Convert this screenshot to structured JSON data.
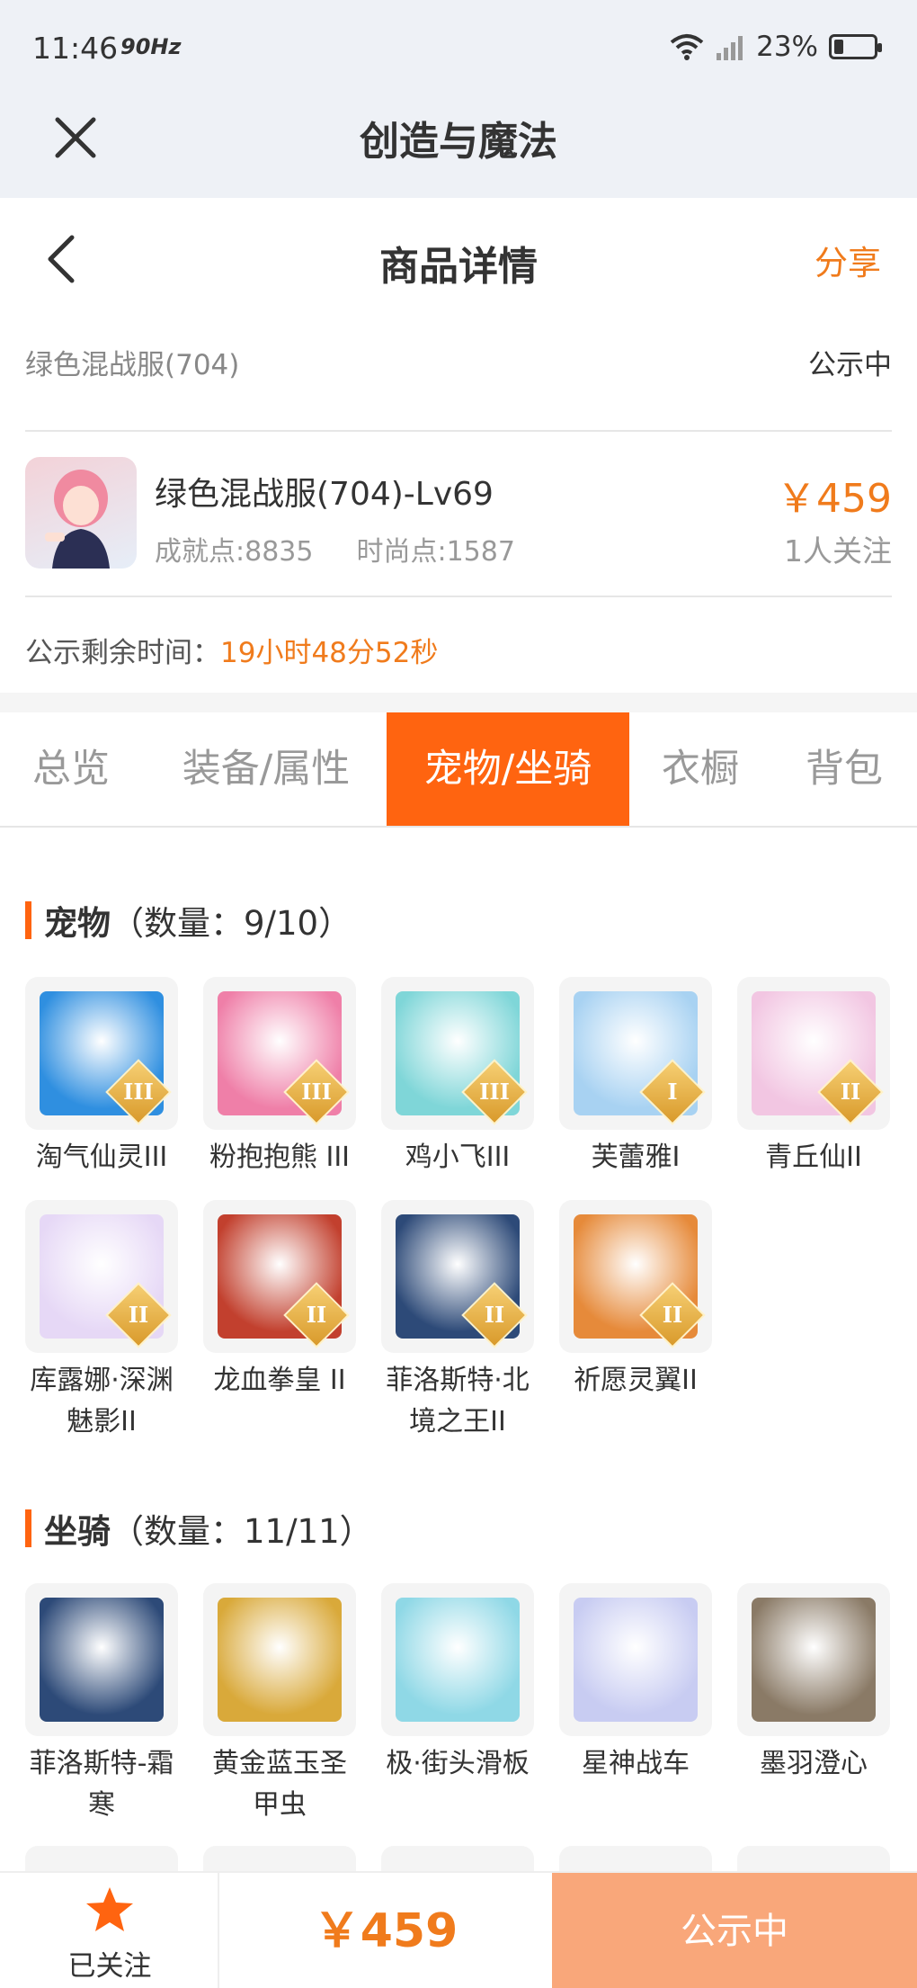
{
  "status_bar": {
    "time": "11:46",
    "refresh": "90Hz",
    "battery": "23%"
  },
  "app": {
    "title": "创造与魔法"
  },
  "page": {
    "title": "商品详情",
    "share": "分享"
  },
  "listing": {
    "name": "绿色混战服(704)",
    "status": "公示中"
  },
  "product": {
    "title": "绿色混战服(704)-Lv69",
    "achievement": "成就点:8835",
    "fashion": "时尚点:1587",
    "price": "￥459",
    "followers": "1人关注"
  },
  "countdown": {
    "label": "公示剩余时间：",
    "value": "19小时48分52秒"
  },
  "tabs": [
    {
      "label": "总览"
    },
    {
      "label": "装备/属性"
    },
    {
      "label": "宠物/坐骑"
    },
    {
      "label": "衣橱"
    },
    {
      "label": "背包"
    }
  ],
  "pets": {
    "title": "宠物",
    "count": "（数量：9/10）",
    "items": [
      {
        "name": "淘气仙灵III",
        "tier": "III",
        "color": "#2f8fe0"
      },
      {
        "name": "粉抱抱熊 III",
        "tier": "III",
        "color": "#ef7fa8"
      },
      {
        "name": "鸡小飞III",
        "tier": "III",
        "color": "#7fd6d8"
      },
      {
        "name": "芙蕾雅I",
        "tier": "I",
        "color": "#a8d2f2"
      },
      {
        "name": "青丘仙II",
        "tier": "II",
        "color": "#f2c6e2"
      },
      {
        "name": "库露娜·深渊魅影II",
        "tier": "II",
        "color": "#e6d8f6"
      },
      {
        "name": "龙血拳皇 II",
        "tier": "II",
        "color": "#c2402e"
      },
      {
        "name": "菲洛斯特·北境之王II",
        "tier": "II",
        "color": "#2d4a78"
      },
      {
        "name": "祈愿灵翼II",
        "tier": "II",
        "color": "#e68a3a"
      }
    ]
  },
  "mounts": {
    "title": "坐骑",
    "count": "（数量：11/11）",
    "items": [
      {
        "name": "菲洛斯特-霜寒",
        "color": "#2d4a78"
      },
      {
        "name": "黄金蓝玉圣甲虫",
        "color": "#d9a93a"
      },
      {
        "name": "极·街头滑板",
        "color": "#8fd8e6"
      },
      {
        "name": "星神战车",
        "color": "#c8ccf2"
      },
      {
        "name": "墨羽澄心",
        "color": "#8a7a66"
      }
    ]
  },
  "bottom": {
    "follow_label": "已关注",
    "price": "￥459",
    "status": "公示中"
  }
}
